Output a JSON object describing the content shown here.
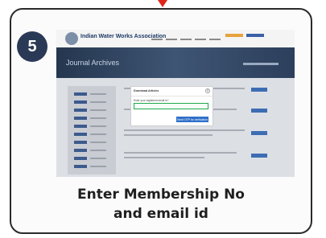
{
  "step": {
    "number": "5"
  },
  "caption": {
    "line1": "Enter Membership No",
    "line2": "and email id"
  },
  "screenshot": {
    "site_name": "Indian Water Works Association",
    "site_tagline": "",
    "banner_title": "Journal Archives",
    "modal": {
      "title": "Download Articles",
      "close_symbol": "×",
      "email_label": "Enter your registered email id *",
      "email_value": "",
      "submit_label": "Send OTP for verification"
    }
  },
  "colors": {
    "accent_arrow": "#e0251b",
    "badge": "#2a3a56",
    "input_focus": "#1fa84a",
    "button": "#2f6fc9"
  }
}
